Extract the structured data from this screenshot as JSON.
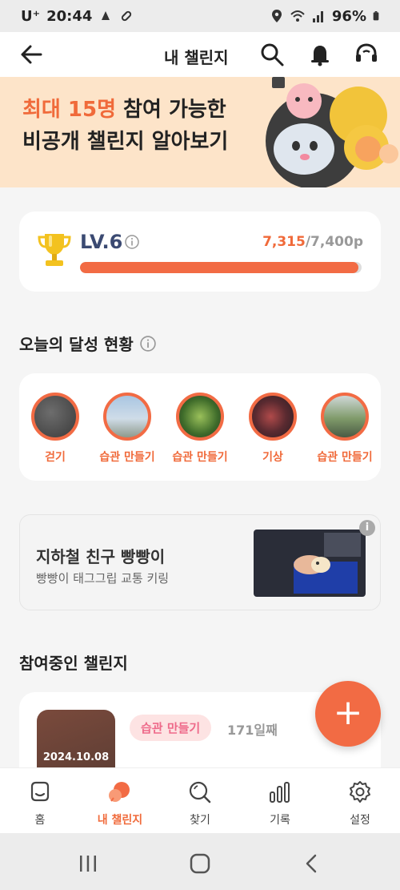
{
  "status_bar": {
    "carrier": "U⁺",
    "time": "20:44",
    "battery": "96%"
  },
  "header": {
    "title": "내 챌린지",
    "back_icon": "back-arrow-icon",
    "icons": [
      "search-icon",
      "bell-icon",
      "support-headset-icon"
    ]
  },
  "banner": {
    "highlight": "최대 15명",
    "line1_rest": " 참여 가능한",
    "line2": "비공개 챌린지 알아보기"
  },
  "level": {
    "label": "LV.6",
    "current_points": "7,315",
    "max_points": "/7,400p",
    "progress": 0.9885
  },
  "today": {
    "title": "오늘의 달성 현황",
    "items": [
      {
        "label": "걷기"
      },
      {
        "label": "습관 만들기"
      },
      {
        "label": "습관 만들기"
      },
      {
        "label": "기상"
      },
      {
        "label": "습관 만들기"
      }
    ]
  },
  "ad": {
    "title": "지하철 친구 빵빵이",
    "subtitle": "빵빵이 태그그립 교통 키링",
    "info": "i"
  },
  "participating": {
    "title": "참여중인 챌린지",
    "item": {
      "date": "2024.10.08",
      "tag": "습관 만들기",
      "days": "171일째"
    }
  },
  "fab": {
    "label": "+"
  },
  "bottom_nav": [
    {
      "label": "홈",
      "icon": "home-icon"
    },
    {
      "label": "내 챌린지",
      "icon": "my-challenge-icon",
      "active": true
    },
    {
      "label": "찾기",
      "icon": "search-icon"
    },
    {
      "label": "기록",
      "icon": "chart-icon"
    },
    {
      "label": "설정",
      "icon": "gear-icon"
    }
  ],
  "colors": {
    "accent": "#f26b44",
    "level_text": "#3b4a72",
    "banner_bg": "#fde4c9"
  }
}
